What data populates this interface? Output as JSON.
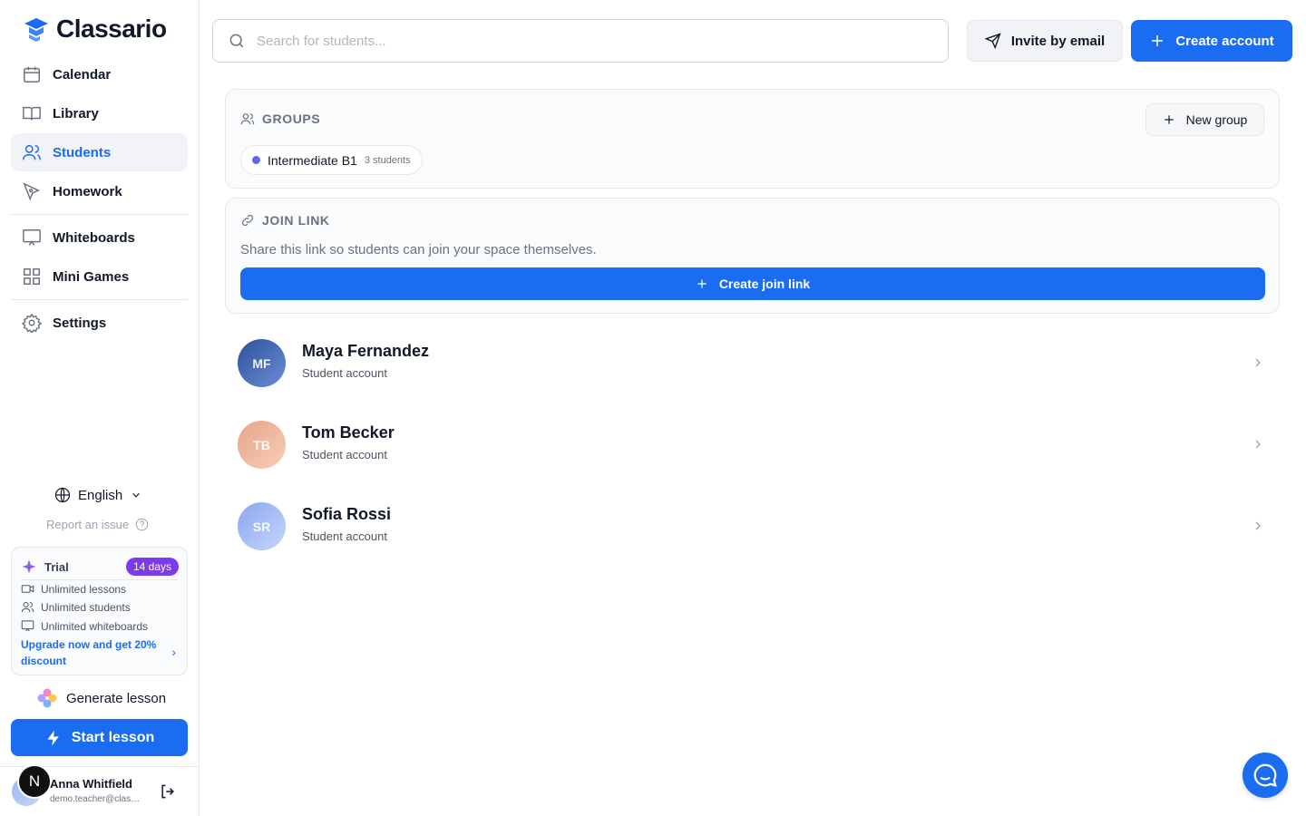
{
  "app": {
    "name": "Classario"
  },
  "sidebar": {
    "items": [
      {
        "label": "Calendar",
        "icon": "calendar-icon"
      },
      {
        "label": "Library",
        "icon": "book-icon"
      },
      {
        "label": "Students",
        "icon": "users-icon",
        "active": true
      },
      {
        "label": "Homework",
        "icon": "pen-icon"
      },
      {
        "label": "Whiteboards",
        "icon": "whiteboard-icon"
      },
      {
        "label": "Mini Games",
        "icon": "grid-icon"
      },
      {
        "label": "Settings",
        "icon": "gear-icon"
      }
    ],
    "language": "English",
    "report_issue": "Report an issue",
    "trial": {
      "title": "Trial",
      "badge": "14 days",
      "features": [
        "Unlimited lessons",
        "Unlimited students",
        "Unlimited whiteboards"
      ],
      "upgrade": "Upgrade now and get 20% discount"
    },
    "generate_lesson": "Generate lesson",
    "start_lesson": "Start lesson",
    "profile": {
      "badge": "N",
      "name": "Anna Whitfield",
      "email": "demo.teacher@classario.com"
    }
  },
  "topbar": {
    "search_placeholder": "Search for students...",
    "invite_label": "Invite by email",
    "create_label": "Create account"
  },
  "groups": {
    "label": "GROUPS",
    "new_group": "New group",
    "items": [
      {
        "name": "Intermediate B1",
        "count": "3 students"
      }
    ]
  },
  "join_link": {
    "label": "JOIN LINK",
    "description": "Share this link so students can join your space themselves.",
    "button": "Create join link"
  },
  "students": [
    {
      "initials": "MF",
      "name": "Maya Fernandez",
      "role": "Student account"
    },
    {
      "initials": "TB",
      "name": "Tom Becker",
      "role": "Student account"
    },
    {
      "initials": "SR",
      "name": "Sofia Rossi",
      "role": "Student account"
    }
  ],
  "colors": {
    "accent": "#1a6cf0",
    "trial_badge": "#7c3aed",
    "group_dot": "#6366f1"
  }
}
